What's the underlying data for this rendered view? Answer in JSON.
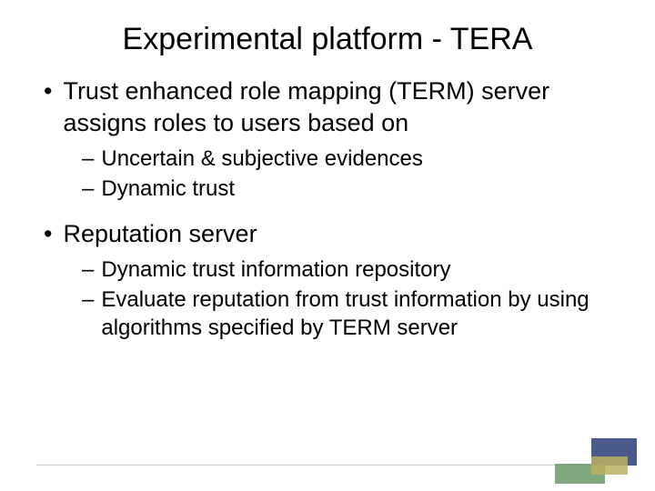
{
  "title": "Experimental platform - TERA",
  "bullets": [
    {
      "level": 1,
      "text": "Trust enhanced role mapping (TERM) server assigns roles to users based on",
      "sub": [
        "Uncertain & subjective evidences",
        "Dynamic trust"
      ]
    },
    {
      "level": 1,
      "text": " Reputation server",
      "sub": [
        "Dynamic trust information repository",
        "Evaluate reputation from trust information by using algorithms specified by TERM server"
      ]
    }
  ]
}
